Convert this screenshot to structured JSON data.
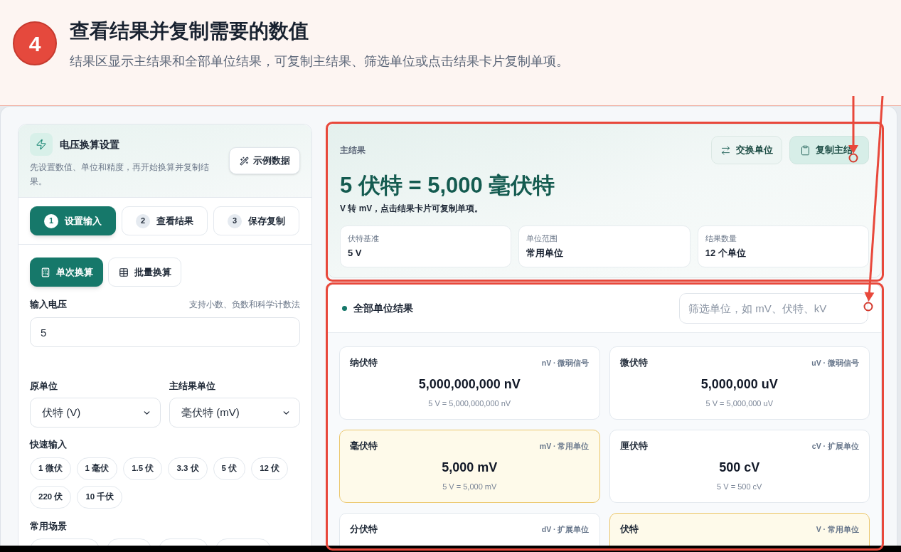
{
  "guide": {
    "step": "4",
    "title": "查看结果并复制需要的数值",
    "description": "结果区显示主结果和全部单位结果，可复制主结果、筛选单位或点击结果卡片复制单项。"
  },
  "settings_panel": {
    "title": "电压换算设置",
    "description": "先设置数值、单位和精度，再开始换算并复制结果。",
    "sample_button": "示例数据",
    "steps": [
      {
        "number": "1",
        "label": "设置输入",
        "selected": true
      },
      {
        "number": "2",
        "label": "查看结果",
        "selected": false
      },
      {
        "number": "3",
        "label": "保存复制",
        "selected": false
      }
    ],
    "modes": [
      {
        "kind": "single",
        "label": "单次换算",
        "selected": true
      },
      {
        "kind": "batch",
        "label": "批量换算",
        "selected": false
      }
    ],
    "input": {
      "label": "输入电压",
      "hint": "支持小数、负数和科学计数法",
      "value": "5"
    },
    "selects": [
      {
        "label": "原单位",
        "value": "伏特 (V)"
      },
      {
        "label": "主结果单位",
        "value": "毫伏特 (mV)"
      }
    ],
    "quick_input": {
      "label": "快速输入",
      "chips": [
        "1 微伏",
        "1 毫伏",
        "1.5 伏",
        "3.3 伏",
        "5 伏",
        "12 伏",
        "220 伏",
        "10 千伏"
      ]
    },
    "scenes": {
      "label": "常用场景"
    }
  },
  "main_result": {
    "label": "主结果",
    "buttons": [
      {
        "kind": "swap",
        "label": "交换单位"
      },
      {
        "kind": "copy",
        "label": "复制主结"
      }
    ],
    "headline": "5 伏特 = 5,000 毫伏特",
    "note": "V 转 mV，点击结果卡片可复制单项。",
    "stats": [
      {
        "label": "伏特基准",
        "value": "5 V"
      },
      {
        "label": "单位范围",
        "value": "常用单位"
      },
      {
        "label": "结果数量",
        "value": "12 个单位"
      }
    ]
  },
  "all_results": {
    "title": "全部单位结果",
    "filter_placeholder": "筛选单位，如 mV、伏特、kV",
    "cards": [
      {
        "name": "纳伏特",
        "tag": "nV · 微弱信号",
        "value": "5,000,000,000 nV",
        "formula": "5 V = 5,000,000,000 nV",
        "highlighted": false
      },
      {
        "name": "微伏特",
        "tag": "uV · 微弱信号",
        "value": "5,000,000 uV",
        "formula": "5 V = 5,000,000 uV",
        "highlighted": false
      },
      {
        "name": "毫伏特",
        "tag": "mV · 常用单位",
        "value": "5,000 mV",
        "formula": "5 V = 5,000 mV",
        "highlighted": true
      },
      {
        "name": "厘伏特",
        "tag": "cV · 扩展单位",
        "value": "500 cV",
        "formula": "5 V = 500 cV",
        "highlighted": false
      },
      {
        "name": "分伏特",
        "tag": "dV · 扩展单位",
        "highlighted": false
      },
      {
        "name": "伏特",
        "tag": "V · 常用单位",
        "highlighted": true
      }
    ]
  }
}
